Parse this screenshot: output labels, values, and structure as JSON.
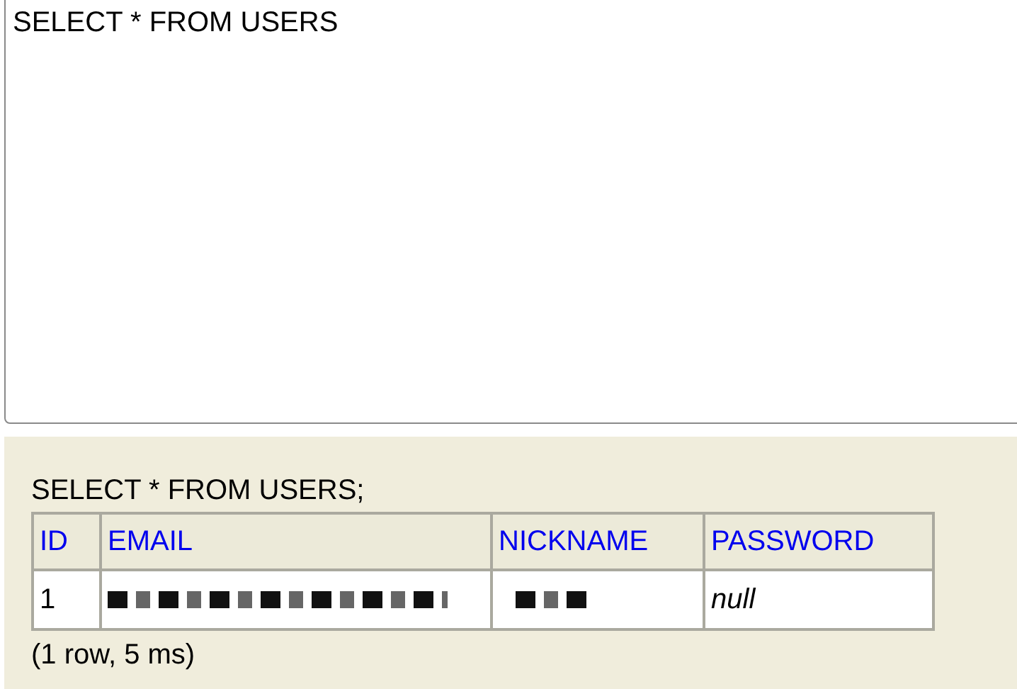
{
  "query_editor": {
    "value": "SELECT * FROM USERS"
  },
  "results": {
    "statement": "SELECT * FROM USERS;",
    "columns": [
      "ID",
      "EMAIL",
      "NICKNAME",
      "PASSWORD"
    ],
    "rows": [
      [
        {
          "kind": "text",
          "text": "1"
        },
        {
          "kind": "redacted"
        },
        {
          "kind": "redacted"
        },
        {
          "kind": "null",
          "text": "null"
        }
      ]
    ],
    "summary": "(1 row, 5 ms)"
  }
}
